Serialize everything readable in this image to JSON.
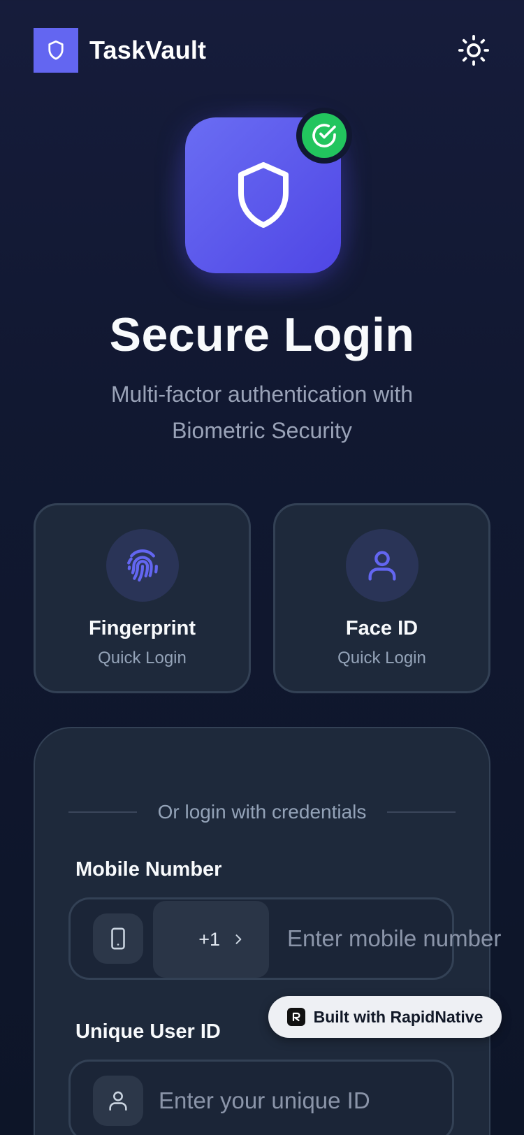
{
  "header": {
    "app_name": "TaskVault",
    "logo_icon": "shield-icon",
    "theme_toggle_icon": "sun-icon"
  },
  "hero": {
    "icon": "shield-icon",
    "badge_icon": "check-circle-icon",
    "title": "Secure Login",
    "subtitle": "Multi-factor authentication with Biometric Security"
  },
  "biometrics": [
    {
      "icon": "fingerprint-icon",
      "title": "Fingerprint",
      "subtitle": "Quick Login"
    },
    {
      "icon": "user-icon",
      "title": "Face ID",
      "subtitle": "Quick Login"
    }
  ],
  "credentials": {
    "divider_text": "Or login with credentials",
    "mobile": {
      "label": "Mobile Number",
      "icon": "smartphone-icon",
      "country_code": "+1",
      "placeholder": "Enter mobile number"
    },
    "user_id": {
      "label": "Unique User ID",
      "icon": "user-icon",
      "placeholder": "Enter your unique ID"
    }
  },
  "watermark": {
    "label": "Built with RapidNative",
    "icon": "rapidnative-logo-icon"
  },
  "colors": {
    "accent": "#6366f1",
    "success": "#22c55e",
    "background": "#111831",
    "card": "#1e293b"
  }
}
